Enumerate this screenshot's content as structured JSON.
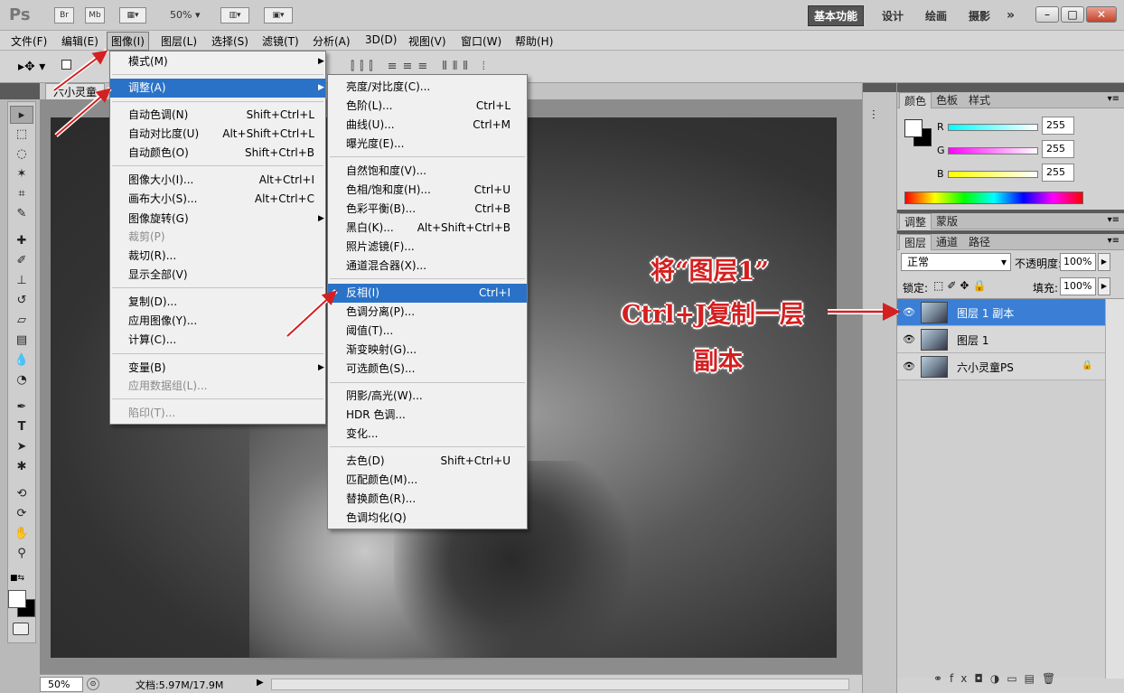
{
  "titlebar": {
    "app_logo": "Ps",
    "bridge": "Br",
    "minibridge": "Mb",
    "zoom": "50%",
    "workspaces": [
      "基本功能",
      "设计",
      "绘画",
      "摄影"
    ],
    "more": "»"
  },
  "menubar": [
    "文件(F)",
    "编辑(E)",
    "图像(I)",
    "图层(L)",
    "选择(S)",
    "滤镜(T)",
    "分析(A)",
    "3D(D)",
    "视图(V)",
    "窗口(W)",
    "帮助(H)"
  ],
  "doc_tab": "六小灵童",
  "image_menu": [
    {
      "label": "模式(M)",
      "submenu": true
    },
    {
      "label": "调整(A)",
      "submenu": true,
      "highlighted": true
    },
    {
      "label": "自动色调(N)",
      "shortcut": "Shift+Ctrl+L"
    },
    {
      "label": "自动对比度(U)",
      "shortcut": "Alt+Shift+Ctrl+L"
    },
    {
      "label": "自动颜色(O)",
      "shortcut": "Shift+Ctrl+B"
    },
    {
      "label": "图像大小(I)...",
      "shortcut": "Alt+Ctrl+I"
    },
    {
      "label": "画布大小(S)...",
      "shortcut": "Alt+Ctrl+C"
    },
    {
      "label": "图像旋转(G)",
      "submenu": true
    },
    {
      "label": "裁剪(P)",
      "disabled": true
    },
    {
      "label": "裁切(R)..."
    },
    {
      "label": "显示全部(V)"
    },
    {
      "label": "复制(D)..."
    },
    {
      "label": "应用图像(Y)..."
    },
    {
      "label": "计算(C)..."
    },
    {
      "label": "变量(B)",
      "submenu": true
    },
    {
      "label": "应用数据组(L)...",
      "disabled": true
    },
    {
      "label": "陷印(T)...",
      "disabled": true
    }
  ],
  "adjust_menu": [
    {
      "label": "亮度/对比度(C)..."
    },
    {
      "label": "色阶(L)...",
      "shortcut": "Ctrl+L"
    },
    {
      "label": "曲线(U)...",
      "shortcut": "Ctrl+M"
    },
    {
      "label": "曝光度(E)..."
    },
    {
      "label": "自然饱和度(V)..."
    },
    {
      "label": "色相/饱和度(H)...",
      "shortcut": "Ctrl+U"
    },
    {
      "label": "色彩平衡(B)...",
      "shortcut": "Ctrl+B"
    },
    {
      "label": "黑白(K)...",
      "shortcut": "Alt+Shift+Ctrl+B"
    },
    {
      "label": "照片滤镜(F)..."
    },
    {
      "label": "通道混合器(X)..."
    },
    {
      "label": "反相(I)",
      "shortcut": "Ctrl+I",
      "highlighted": true
    },
    {
      "label": "色调分离(P)..."
    },
    {
      "label": "阈值(T)..."
    },
    {
      "label": "渐变映射(G)..."
    },
    {
      "label": "可选颜色(S)..."
    },
    {
      "label": "阴影/高光(W)..."
    },
    {
      "label": "HDR 色调..."
    },
    {
      "label": "变化..."
    },
    {
      "label": "去色(D)",
      "shortcut": "Shift+Ctrl+U"
    },
    {
      "label": "匹配颜色(M)..."
    },
    {
      "label": "替换颜色(R)..."
    },
    {
      "label": "色调均化(Q)"
    }
  ],
  "color_panel": {
    "tabs": [
      "颜色",
      "色板",
      "样式"
    ],
    "channels": [
      {
        "name": "R",
        "value": "255",
        "color": "#00ffff"
      },
      {
        "name": "G",
        "value": "255",
        "color": "#ff00ff"
      },
      {
        "name": "B",
        "value": "255",
        "color": "#ffff00"
      }
    ]
  },
  "adjust_panel_tabs": [
    "调整",
    "蒙版"
  ],
  "layers_panel": {
    "tabs": [
      "图层",
      "通道",
      "路径"
    ],
    "blend_mode": "正常",
    "opacity_label": "不透明度:",
    "opacity": "100%",
    "lock_label": "锁定:",
    "fill_label": "填充:",
    "fill": "100%",
    "layers": [
      {
        "name": "图层 1 副本",
        "selected": true
      },
      {
        "name": "图层 1"
      },
      {
        "name": "六小灵童PS",
        "locked": true
      }
    ]
  },
  "status": {
    "zoom": "50%",
    "docsize": "文档:5.97M/17.9M"
  },
  "annotation": {
    "line1": "将“图层1”",
    "line2": "Ctrl+J复制一层",
    "line3": "副本"
  },
  "accent_color": "#2a72c8",
  "annotation_color": "#d42020"
}
